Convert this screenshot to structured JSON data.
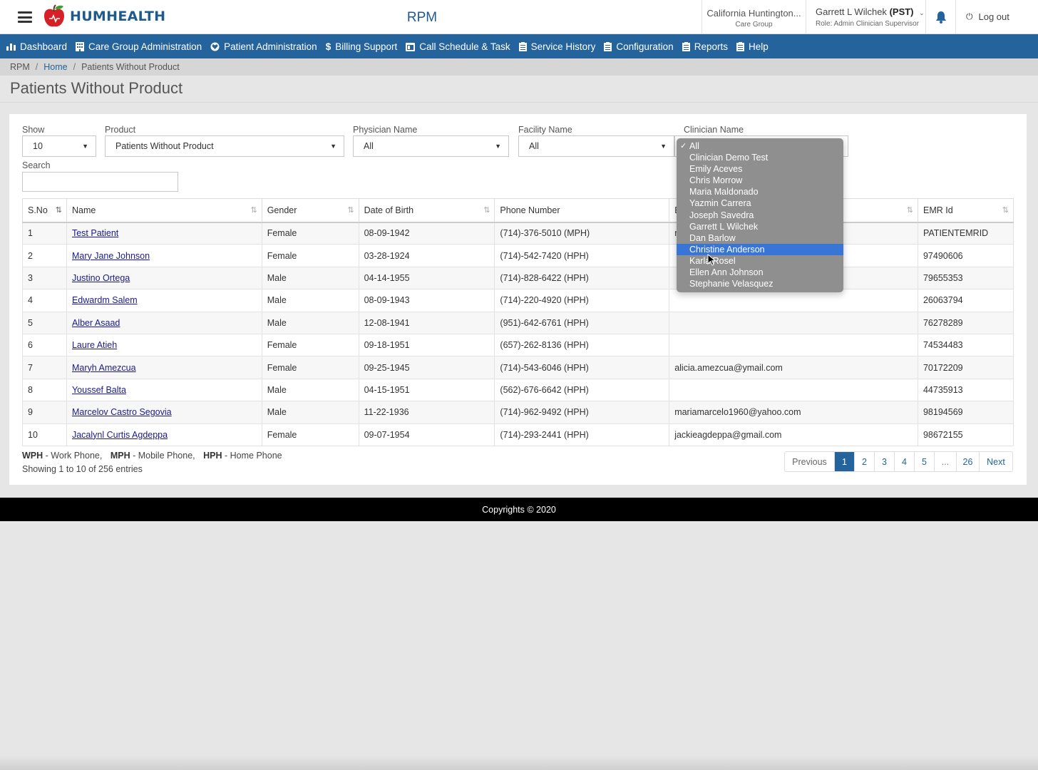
{
  "header": {
    "brand": "HUMHEALTH",
    "app_title": "RPM",
    "org_name": "California Huntington...",
    "org_type": "Care Group",
    "user_name": "Garrett L Wilchek",
    "user_tz": "(PST)",
    "user_role": "Role: Admin Clinician Supervisor",
    "logout_label": "Log out"
  },
  "nav": {
    "items": [
      {
        "label": "Dashboard",
        "icon": "bar-chart-icon"
      },
      {
        "label": "Care Group Administration",
        "icon": "building-icon"
      },
      {
        "label": "Patient Administration",
        "icon": "heart-icon"
      },
      {
        "label": "Billing Support",
        "icon": "dollar-icon"
      },
      {
        "label": "Call Schedule & Task",
        "icon": "calendar-icon"
      },
      {
        "label": "Service History",
        "icon": "clipboard-icon"
      },
      {
        "label": "Configuration",
        "icon": "clipboard-icon"
      },
      {
        "label": "Reports",
        "icon": "clipboard-icon"
      },
      {
        "label": "Help",
        "icon": "clipboard-icon"
      }
    ]
  },
  "breadcrumb": {
    "root": "RPM",
    "home": "Home",
    "current": "Patients Without Product"
  },
  "page": {
    "title": "Patients Without Product"
  },
  "filters": {
    "show_label": "Show",
    "show_value": "10",
    "product_label": "Product",
    "product_value": "Patients Without Product",
    "physician_label": "Physician Name",
    "physician_value": "All",
    "facility_label": "Facility Name",
    "facility_value": "All",
    "clinician_label": "Clinician Name",
    "search_label": "Search",
    "search_value": ""
  },
  "clinician_dropdown": {
    "selected": "All",
    "highlighted": "Christine Anderson",
    "options": [
      "All",
      "Clinician Demo Test",
      "Emily Aceves",
      "Chris Morrow",
      "Maria Maldonado",
      "Yazmin Carrera",
      "Joseph Savedra",
      "Garrett L Wilchek",
      "Dan Barlow",
      "Christine Anderson",
      "Karla Rosel",
      "Ellen Ann Johnson",
      "Stephanie Velasquez"
    ]
  },
  "table": {
    "columns": [
      "S.No",
      "Name",
      "Gender",
      "Date of Birth",
      "Phone Number",
      "E",
      "EMR Id"
    ],
    "rows": [
      {
        "sno": "1",
        "name": "Test Patient",
        "gender": "Female",
        "dob": "08-09-1942",
        "phone": "(714)-376-5010 (MPH)",
        "email": "r",
        "emr": "PATIENTEMRID"
      },
      {
        "sno": "2",
        "name": "Mary Jane Johnson",
        "gender": "Female",
        "dob": "03-28-1924",
        "phone": "(714)-542-7420 (HPH)",
        "email": "",
        "emr": "97490606"
      },
      {
        "sno": "3",
        "name": "Justino Ortega",
        "gender": "Male",
        "dob": "04-14-1955",
        "phone": "(714)-828-6422 (HPH)",
        "email": "",
        "emr": "79655353"
      },
      {
        "sno": "4",
        "name": "Edwardm Salem",
        "gender": "Male",
        "dob": "08-09-1943",
        "phone": "(714)-220-4920 (HPH)",
        "email": "",
        "emr": "26063794"
      },
      {
        "sno": "5",
        "name": "Alber Asaad",
        "gender": "Male",
        "dob": "12-08-1941",
        "phone": "(951)-642-6761 (HPH)",
        "email": "",
        "emr": "76278289"
      },
      {
        "sno": "6",
        "name": "Laure Atieh",
        "gender": "Female",
        "dob": "09-18-1951",
        "phone": "(657)-262-8136 (HPH)",
        "email": "",
        "emr": "74534483"
      },
      {
        "sno": "7",
        "name": "Maryh Amezcua",
        "gender": "Female",
        "dob": "09-25-1945",
        "phone": "(714)-543-6046 (HPH)",
        "email": "alicia.amezcua@ymail.com",
        "emr": "70172209"
      },
      {
        "sno": "8",
        "name": "Youssef Balta",
        "gender": "Male",
        "dob": "04-15-1951",
        "phone": "(562)-676-6642 (HPH)",
        "email": "",
        "emr": "44735913"
      },
      {
        "sno": "9",
        "name": "Marcelov Castro Segovia",
        "gender": "Male",
        "dob": "11-22-1936",
        "phone": "(714)-962-9492 (HPH)",
        "email": "mariamarcelo1960@yahoo.com",
        "emr": "98194569"
      },
      {
        "sno": "10",
        "name": "Jacalynl Curtis Agdeppa",
        "gender": "Female",
        "dob": "09-07-1954",
        "phone": "(714)-293-2441 (HPH)",
        "email": "jackieagdeppa@gmail.com",
        "emr": "98672155"
      }
    ]
  },
  "legend": {
    "wph_abbr": "WPH",
    "wph_text": "- Work Phone,",
    "mph_abbr": "MPH",
    "mph_text": "- Mobile Phone,",
    "hph_abbr": "HPH",
    "hph_text": "- Home Phone",
    "showing": "Showing 1 to 10 of 256 entries"
  },
  "pagination": {
    "previous": "Previous",
    "pages": [
      "1",
      "2",
      "3",
      "4",
      "5",
      "...",
      "26"
    ],
    "active": "1",
    "next": "Next"
  },
  "footer": {
    "copyright": "Copyrights © 2020"
  },
  "colors": {
    "brand_blue": "#24639c",
    "highlight": "#3875d7",
    "dropdown_bg": "#8f8f8f"
  }
}
